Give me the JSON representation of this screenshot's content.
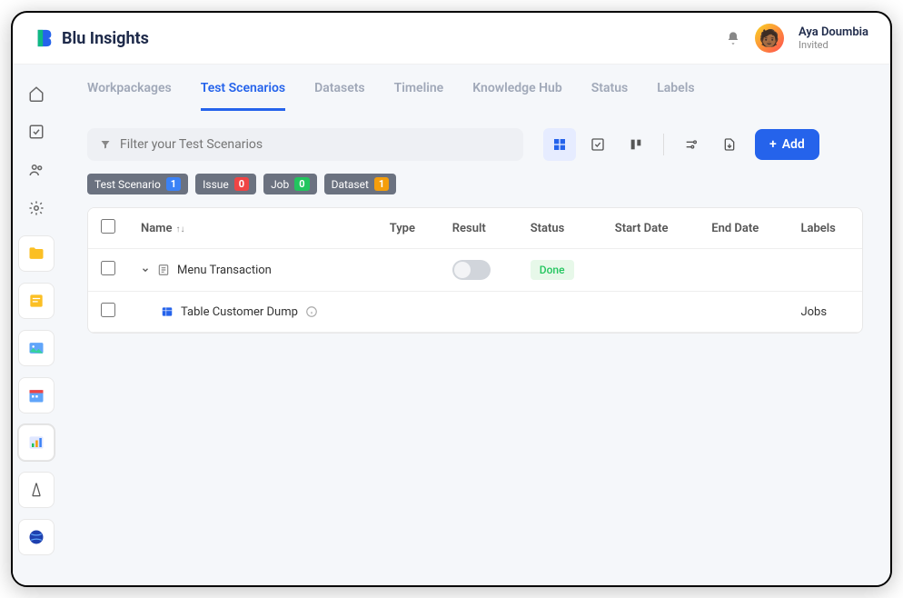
{
  "app": {
    "name": "Blu Insights"
  },
  "user": {
    "name": "Aya Doumbia",
    "role": "Invited"
  },
  "tabs": [
    {
      "label": "Workpackages"
    },
    {
      "label": "Test Scenarios"
    },
    {
      "label": "Datasets"
    },
    {
      "label": "Timeline"
    },
    {
      "label": "Knowledge Hub"
    },
    {
      "label": "Status"
    },
    {
      "label": "Labels"
    }
  ],
  "filter": {
    "placeholder": "Filter your Test Scenarios"
  },
  "toolbar": {
    "add_label": "Add"
  },
  "chips": [
    {
      "label": "Test Scenario",
      "count": "1",
      "color": "b-blue"
    },
    {
      "label": "Issue",
      "count": "0",
      "color": "b-red"
    },
    {
      "label": "Job",
      "count": "0",
      "color": "b-green"
    },
    {
      "label": "Dataset",
      "count": "1",
      "color": "b-orange"
    }
  ],
  "columns": {
    "name": "Name",
    "type": "Type",
    "result": "Result",
    "status": "Status",
    "start": "Start Date",
    "end": "End Date",
    "labels": "Labels"
  },
  "rows": [
    {
      "name": "Menu Transaction",
      "status": "Done",
      "kind": "scenario"
    },
    {
      "name": "Table Customer Dump",
      "labels": "Jobs",
      "kind": "table"
    }
  ]
}
